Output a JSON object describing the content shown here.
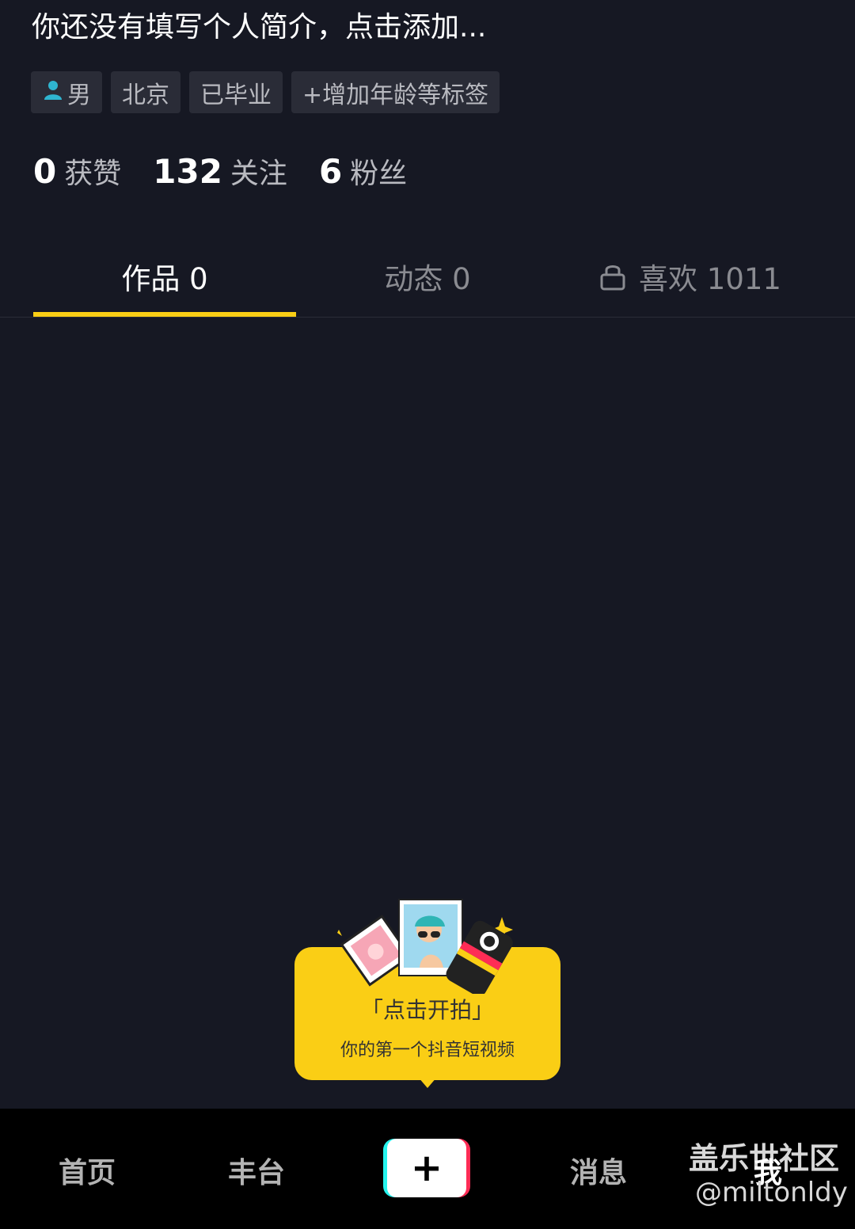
{
  "profile": {
    "bio_placeholder": "你还没有填写个人简介，点击添加...",
    "tags": [
      {
        "icon": "person-icon",
        "label": "男"
      },
      {
        "label": "北京"
      },
      {
        "label": "已毕业"
      },
      {
        "label": "+增加年龄等标签"
      }
    ],
    "stats": [
      {
        "num": "0",
        "label": "获赞"
      },
      {
        "num": "132",
        "label": "关注"
      },
      {
        "num": "6",
        "label": "粉丝"
      }
    ]
  },
  "tabs": [
    {
      "label": "作品 0",
      "active": true
    },
    {
      "label": "动态 0",
      "active": false
    },
    {
      "icon": "lock-icon",
      "label": "喜欢 1011",
      "active": false
    }
  ],
  "prompt": {
    "title": "「点击开拍」",
    "subtitle": "你的第一个抖音短视频"
  },
  "bottom_nav": {
    "home": "首页",
    "second": "丰台",
    "plus_symbol": "+",
    "messages": "消息",
    "me": "我"
  },
  "watermark": {
    "main": "盖乐世社区",
    "sub": "@miltonldy"
  },
  "colors": {
    "background": "#161823",
    "accent": "#face15",
    "tag_bg": "#2a2c37"
  }
}
